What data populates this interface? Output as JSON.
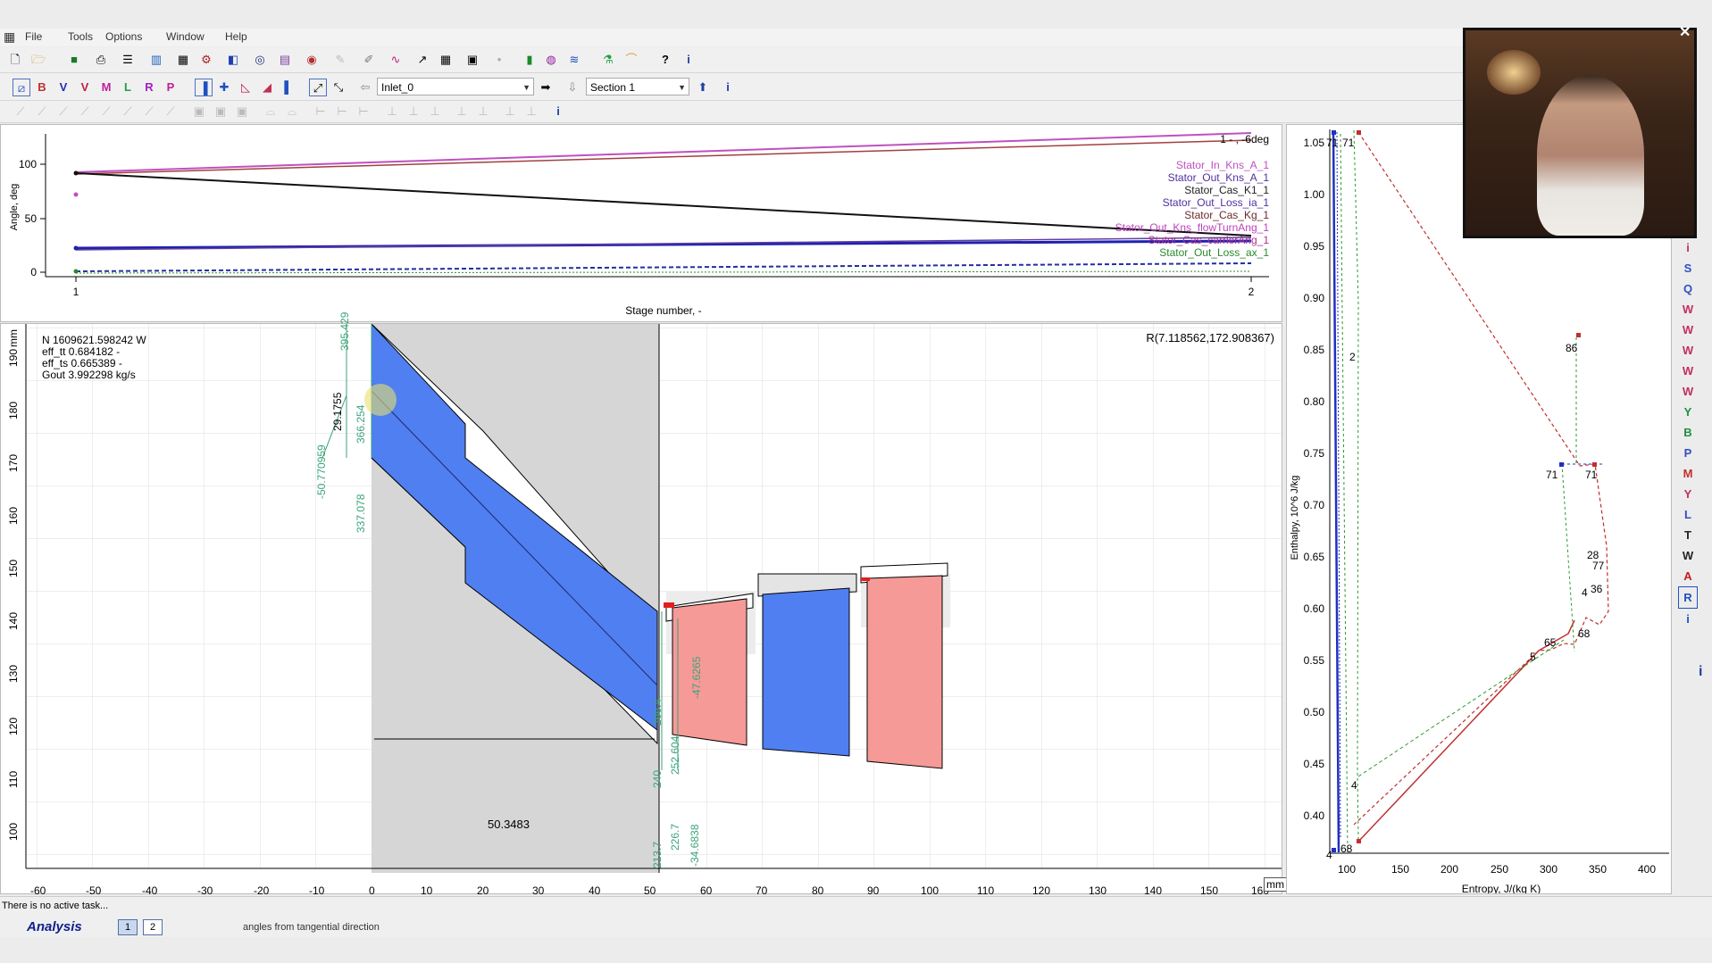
{
  "menu": [
    "File",
    "Tools",
    "Options",
    "Window",
    "Help"
  ],
  "toolbar2": {
    "inlet_select": "Inlet_0",
    "section_select": "Section 1"
  },
  "angle_chart": {
    "ylabel": "Angle, deg",
    "xlabel": "Stage number, -",
    "x_ticks": [
      "1",
      "2"
    ],
    "y_ticks": [
      "100",
      "50",
      "0"
    ],
    "corner_label": "1 - , -6deg",
    "legend": [
      "Stator_In_Kns_A_1",
      "Stator_Out_Kns_A_1",
      "Stator_Cas_K1_1",
      "Stator_Out_Loss_ia_1",
      "Stator_Cas_Kg_1",
      "Stator_Out_Kns_flowTurnAng_1",
      "Stator_Cas_carrierAng_1",
      "Stator_Out_Loss_ax_1"
    ],
    "legend_colors": [
      "#c050c0",
      "#5030a0",
      "#222222",
      "#5030a0",
      "#6b2a2a",
      "#c040c0",
      "#b03090",
      "#2a8a2a"
    ]
  },
  "stage_view": {
    "info": [
      "N 1609621.598242 W",
      "eff_tt 0.684182 -",
      "eff_ts 0.665389 -",
      "Gout 3.992298 kg/s"
    ],
    "cursor_readout": "R(7.118562,172.908367)",
    "x_unit": "mm",
    "y_unit": "mm",
    "x_ticks": [
      "-60",
      "-50",
      "-40",
      "-30",
      "-20",
      "-10",
      "0",
      "10",
      "20",
      "30",
      "40",
      "50",
      "60",
      "70",
      "80",
      "90",
      "100",
      "110",
      "120",
      "130",
      "140",
      "150",
      "160"
    ],
    "y_ticks": [
      "190",
      "180",
      "170",
      "160",
      "150",
      "140",
      "130",
      "120",
      "110",
      "100"
    ],
    "dims": {
      "d1": "395.429",
      "d2": "366.254",
      "d3": "337.078",
      "d4": "29.1755",
      "d5": "-50.770959",
      "d6": "50.3483",
      "d7": "266.4",
      "d8": "240",
      "d9": "213.7",
      "d10": "-47.6265",
      "d11": "-34.6838",
      "d12": "252.604",
      "d13": "226.7"
    }
  },
  "hs_chart": {
    "xlabel": "Entropy, J/(kg K)",
    "ylabel": "Enthalpy, 10^6 J/kg",
    "x_ticks": [
      "100",
      "150",
      "200",
      "250",
      "300",
      "350",
      "400"
    ],
    "y_ticks": [
      "1.05",
      "1.00",
      "0.95",
      "0.90",
      "0.85",
      "0.80",
      "0.75",
      "0.70",
      "0.65",
      "0.60",
      "0.55",
      "0.50",
      "0.45",
      "0.40"
    ],
    "point_labels": [
      "71",
      "71",
      "2",
      "86",
      "71",
      "71",
      "28",
      "77",
      "4",
      "36",
      "68",
      "65",
      "5",
      "4",
      "4",
      "68"
    ]
  },
  "status": {
    "task": "There is no active task...",
    "hint": "angles from tangential direction"
  },
  "tabs": {
    "name": "Analysis",
    "pages": [
      "1",
      "2"
    ]
  },
  "colors": {
    "blade_blue": "#4f7ff0",
    "blade_red": "#f59a97",
    "dim_green": "#3aa37a",
    "grid": "#d8d8d8"
  }
}
